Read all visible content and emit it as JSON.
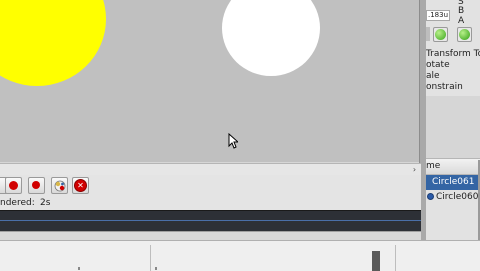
{
  "viewport": {
    "background": "#c0c0c0",
    "sun_color": "#ffff00",
    "moon_color": "#ffffff"
  },
  "scrollbar": {
    "arrow_icon": "chevron-right-icon",
    "arrow_glyph": "›"
  },
  "timeline_toolbar": {
    "buttons": [
      {
        "name": "record-button",
        "icon": "record-icon"
      },
      {
        "name": "record-keyframe-button",
        "icon": "record-icon"
      },
      {
        "name": "keying-set-button",
        "icon": "keying-icon"
      },
      {
        "name": "remove-keyframe-button",
        "icon": "close-circle-icon"
      }
    ]
  },
  "status": {
    "rendered_label": "ndered:",
    "rendered_value": "2s"
  },
  "properties_panel": {
    "top_lines": [
      "S",
      "B",
      "A"
    ],
    "coord_value": ".183u",
    "menu_items": [
      "Transform To",
      "otate",
      "ale",
      "onstrain"
    ],
    "column_header": "me",
    "rows": [
      {
        "label": "Circle061",
        "selected": true
      },
      {
        "label": "Circle060",
        "selected": false
      }
    ]
  },
  "colors": {
    "selection": "#3465a4",
    "panel_bg": "#e2e2e2",
    "record_red": "#d10000",
    "timeline_dark": "#2d3036"
  }
}
